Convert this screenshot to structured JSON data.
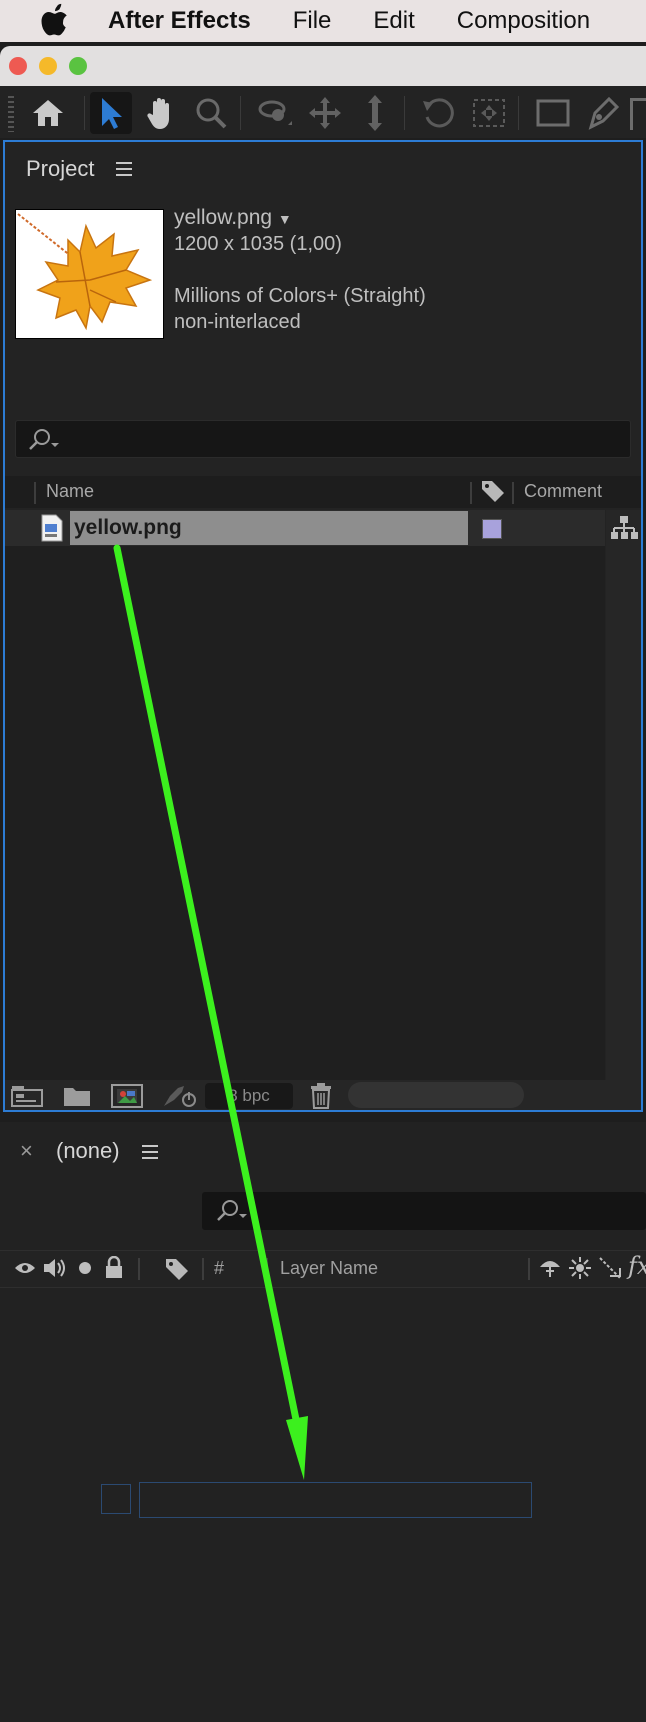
{
  "menubar": {
    "apple_icon": "apple-logo",
    "app_name": "After Effects",
    "items": [
      "File",
      "Edit",
      "Composition"
    ]
  },
  "window": {
    "traffic_lights": [
      "#ee5a52",
      "#f5b92a",
      "#5ac341"
    ]
  },
  "toolbar": {
    "tools": [
      "home-icon",
      "selection-tool-icon",
      "hand-tool-icon",
      "zoom-tool-icon",
      "orbit-camera-icon",
      "pan-camera-icon",
      "dolly-camera-icon",
      "rotate-tool-icon",
      "pan-behind-icon",
      "rectangle-tool-icon",
      "pen-tool-icon"
    ],
    "active_tool": "selection-tool-icon",
    "active_color": "#2d7cd4"
  },
  "project": {
    "title": "Project",
    "asset": {
      "name": "yellow.png",
      "dimensions": "1200 x 1035 (1,00)",
      "colors": "Millions of Colors+ (Straight)",
      "interlace": "non-interlaced"
    },
    "columns": {
      "name": "Name",
      "comment": "Comment"
    },
    "items": [
      {
        "name": "yellow.png",
        "label_color": "#a8a2dc"
      }
    ],
    "footer": {
      "bpc": "8 bpc"
    }
  },
  "timeline": {
    "close": "×",
    "title": "(none)",
    "columns": {
      "number": "#",
      "layer_name": "Layer Name"
    }
  },
  "annotation": {
    "arrow_color": "#3cf01e"
  }
}
